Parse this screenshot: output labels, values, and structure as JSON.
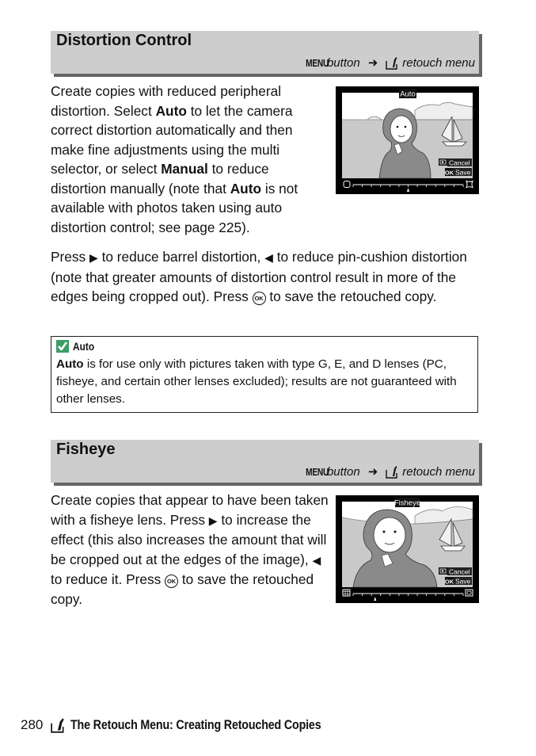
{
  "sections": [
    {
      "title": "Distortion Control",
      "path": {
        "menu_key": "MENU",
        "menu_word": "button",
        "arrow": "➜",
        "dest": "retouch menu",
        "dest_icon": "retouch-menu-icon"
      },
      "paragraph1": {
        "t1": "Create copies with reduced peripheral distortion.  Select ",
        "b1": "Auto",
        "t2": " to let the camera correct distortion automatically and then make fine adjustments using the multi selector, or select ",
        "b2": "Manual",
        "t3": " to reduce distortion manually (note that ",
        "b3": "Auto",
        "t4": " is not available with photos taken using auto distortion control; see page 225)."
      },
      "paragraph2": {
        "t1": "Press ",
        "right_icon": "▶",
        "t2": " to reduce barrel distortion, ",
        "left_icon": "◀",
        "t3": " to reduce pin-cushion distortion (note that greater amounts of distortion control result in more of the edges being cropped out).  Press ",
        "ok_icon": "OK",
        "t4": " to save the retouched copy."
      },
      "screen": {
        "label": "Auto",
        "cancel_key": "▶",
        "cancel_label": "Cancel",
        "save_key": "OK",
        "save_label": "Save",
        "slider_value": 0.5,
        "slider_left_icon": "barrel-icon",
        "slider_right_icon": "pincushion-icon"
      }
    },
    {
      "title": "Fisheye",
      "path": {
        "menu_key": "MENU",
        "menu_word": "button",
        "arrow": "➜",
        "dest": "retouch menu",
        "dest_icon": "retouch-menu-icon"
      },
      "paragraph1": {
        "t1": "Create copies that appear to have been taken with a fisheye lens.  Press ",
        "right_icon": "▶",
        "t2": " to increase the effect (this also increases the amount that will be cropped out at the edges of the image), ",
        "left_icon": "◀",
        "t3": " to reduce it.  Press ",
        "ok_icon": "OK",
        "t4": " to save the retouched copy."
      },
      "screen": {
        "label": "Fisheye",
        "cancel_key": "▶",
        "cancel_label": "Cancel",
        "save_key": "OK",
        "save_label": "Save",
        "slider_value": 0.2,
        "slider_left_icon": "grid-flat-icon",
        "slider_right_icon": "grid-fisheye-icon"
      }
    }
  ],
  "note": {
    "title": "Auto",
    "icon": "check-icon",
    "icon_color": "#3a9e66",
    "b1": "Auto",
    "text": " is for use only with pictures taken with type G, E, and D lenses (PC, fisheye, and certain other lenses excluded); results are not guaranteed with other lenses."
  },
  "footer": {
    "page_number": "280",
    "icon": "retouch-menu-icon",
    "title": "The Retouch Menu: Creating Retouched Copies"
  }
}
